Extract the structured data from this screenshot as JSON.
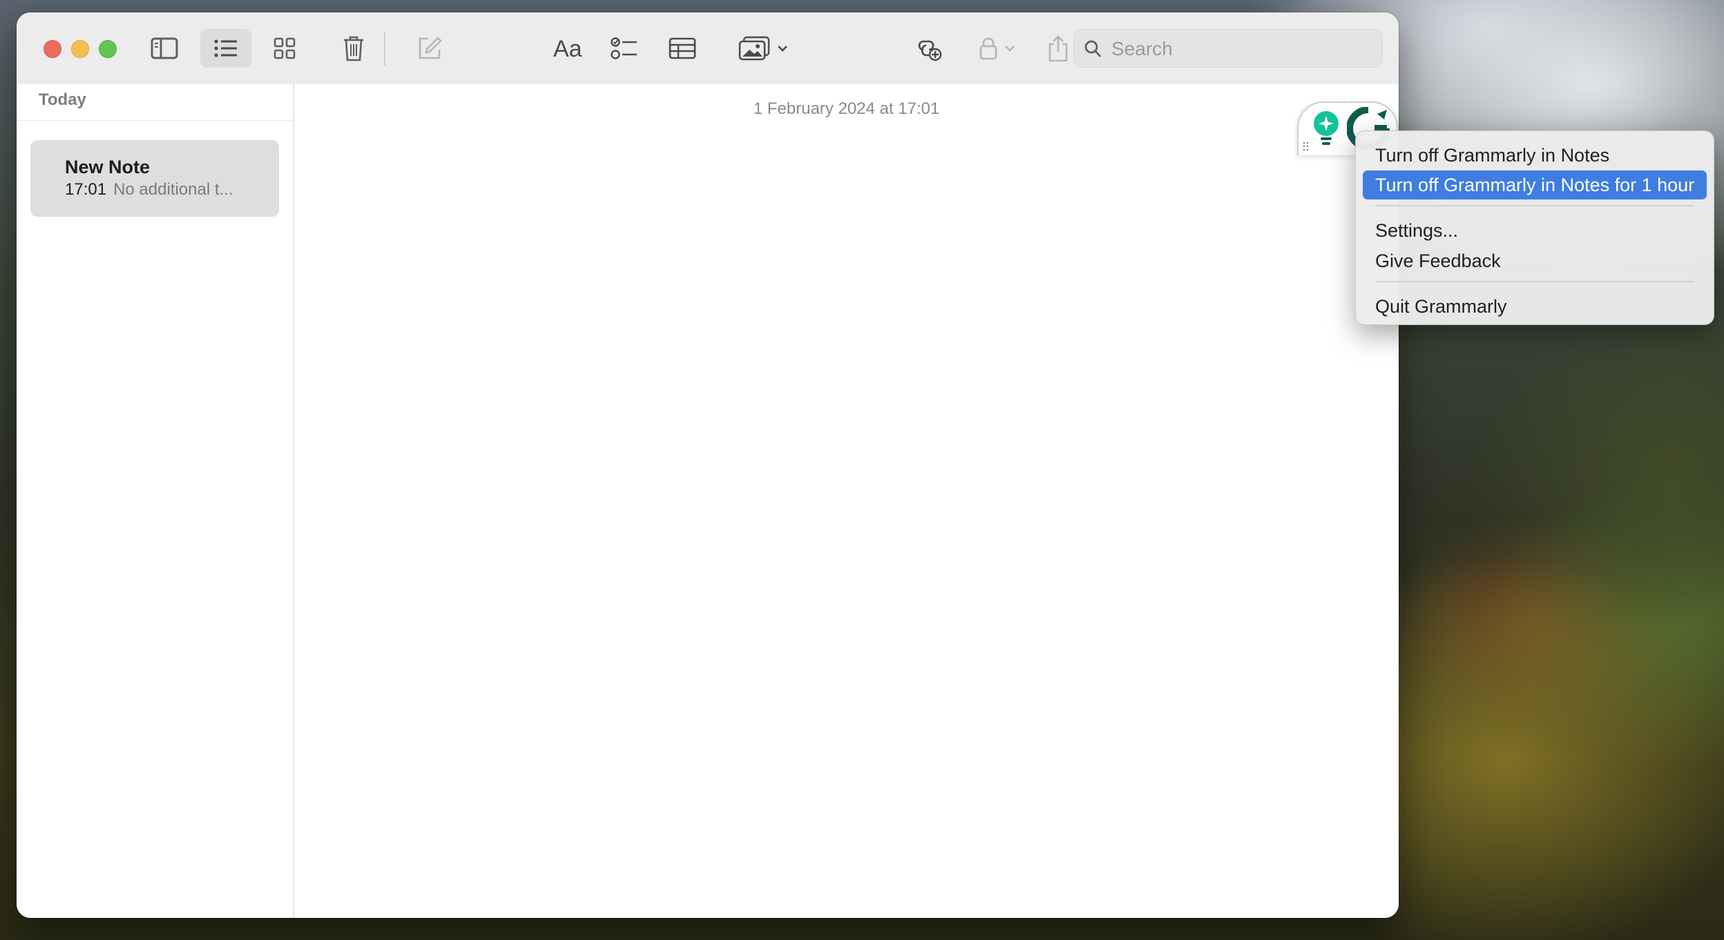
{
  "toolbar": {
    "search_placeholder": "Search"
  },
  "sidebar": {
    "section_title": "Today",
    "notes": [
      {
        "title": "New Note",
        "time": "17:01",
        "preview": "No additional t..."
      }
    ]
  },
  "editor": {
    "date": "1 February 2024 at 17:01"
  },
  "grammarly_menu": {
    "items": [
      {
        "label": "Turn off Grammarly in Notes"
      },
      {
        "label": "Turn off Grammarly in Notes for 1 hour"
      },
      {
        "label": "Settings..."
      },
      {
        "label": "Give Feedback"
      },
      {
        "label": "Quit Grammarly"
      }
    ]
  },
  "colors": {
    "menu_highlight": "#3f7de0",
    "grammarly_green": "#15c39a",
    "grammarly_dark": "#0f5d4f",
    "close": "#ed6a5e",
    "minimize": "#f5bf4f",
    "maximize": "#61c554"
  },
  "icons": {
    "sidebar_toggle": "sidebar-icon",
    "list_view": "list-icon",
    "gallery_view": "grid-icon",
    "delete": "trash-icon",
    "compose": "compose-icon",
    "format": "text-format-icon",
    "checklist": "checklist-icon",
    "table": "table-icon",
    "media": "photo-icon",
    "collaborate": "collaborate-icon",
    "lock": "lock-icon",
    "share": "share-icon",
    "search": "search-icon"
  }
}
